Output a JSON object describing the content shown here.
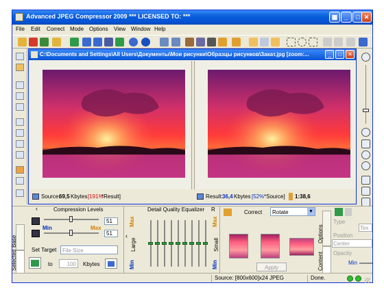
{
  "window": {
    "title": "Advanced JPEG Compressor 2009   *** LICENSED TO:  ***"
  },
  "menu": [
    "File",
    "Edit",
    "Correct",
    "Mode",
    "Options",
    "View",
    "Window",
    "Help"
  ],
  "document": {
    "title": "C:\\Documents and Settings\\All Users\\Документы\\Мои рисунки\\Образцы рисунков\\Закат.jpg  [zoom:..."
  },
  "source_status": {
    "prefix": "Source:",
    "size": "69,5",
    "unit": "Kbytes",
    "percent": "[191%",
    "suffix": "*Result]"
  },
  "result_status": {
    "prefix": "Result:",
    "size": "36,4",
    "unit": "Kbytes",
    "percent": "[52%",
    "suffix": "*Source]",
    "ratio": "1:38,6"
  },
  "compression": {
    "title": "Compression Levels",
    "min": "Min",
    "max": "Max",
    "level1": "51",
    "level2": "51",
    "set_target": "Set Target",
    "target_mode": "File Size",
    "to": "to",
    "target_value": "100",
    "target_unit": "Kbytes"
  },
  "tabs_left": {
    "base": "Base",
    "selected": "Selected"
  },
  "equalizer": {
    "title": "Detail Quality Equalizer",
    "large": "Large",
    "small": "Small",
    "max": "Max",
    "min": "Min",
    "r": "R"
  },
  "correct": {
    "label": "Correct",
    "mode": "Rotate",
    "apply": "Apply"
  },
  "tabs_right": {
    "options": "Options",
    "content": "Content"
  },
  "text_panel": {
    "type_label": "Type",
    "type_value": "Tex",
    "position_label": "Position",
    "position_value": "Center",
    "opacity_label": "Opacity",
    "opacity_min": "Min"
  },
  "statusbar": {
    "source_info": "Source: [800x600]x24 JPEG",
    "state": "Done."
  }
}
